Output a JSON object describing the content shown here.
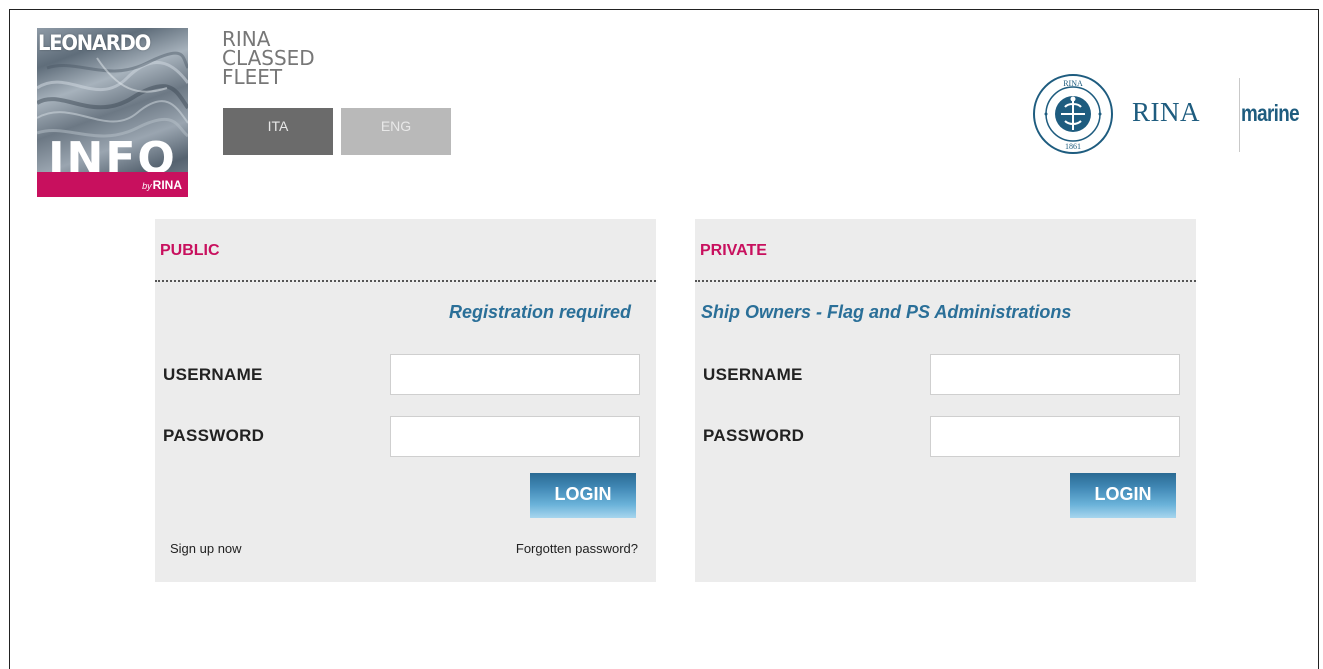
{
  "header": {
    "logo": {
      "top_word": "LEONARDO",
      "big_word": "INFO",
      "by": "by",
      "brand": "RINA"
    },
    "fleet_title": [
      "RINA",
      "CLASSED",
      "FLEET"
    ],
    "languages": [
      {
        "label": "ITA"
      },
      {
        "label": "ENG"
      }
    ],
    "partner_logo": {
      "name": "RINA",
      "suffix": "marine",
      "seal_top_text": "RINA",
      "seal_bottom_text": "1861"
    }
  },
  "panels": {
    "public": {
      "title": "PUBLIC",
      "subtitle": "Registration required",
      "username_label": "USERNAME",
      "password_label": "PASSWORD",
      "username_value": "",
      "password_value": "",
      "login_label": "LOGIN",
      "signup_link": "Sign up now",
      "forgot_link": "Forgotten password?"
    },
    "private": {
      "title": "PRIVATE",
      "subtitle": "Ship Owners - Flag and PS Administrations",
      "username_label": "USERNAME",
      "password_label": "PASSWORD",
      "username_value": "",
      "password_value": "",
      "login_label": "LOGIN"
    }
  },
  "colors": {
    "accent_pink": "#c8105e",
    "rina_blue": "#1e5c7f",
    "subtitle_blue": "#2a6f98",
    "panel_bg": "#ececec"
  }
}
